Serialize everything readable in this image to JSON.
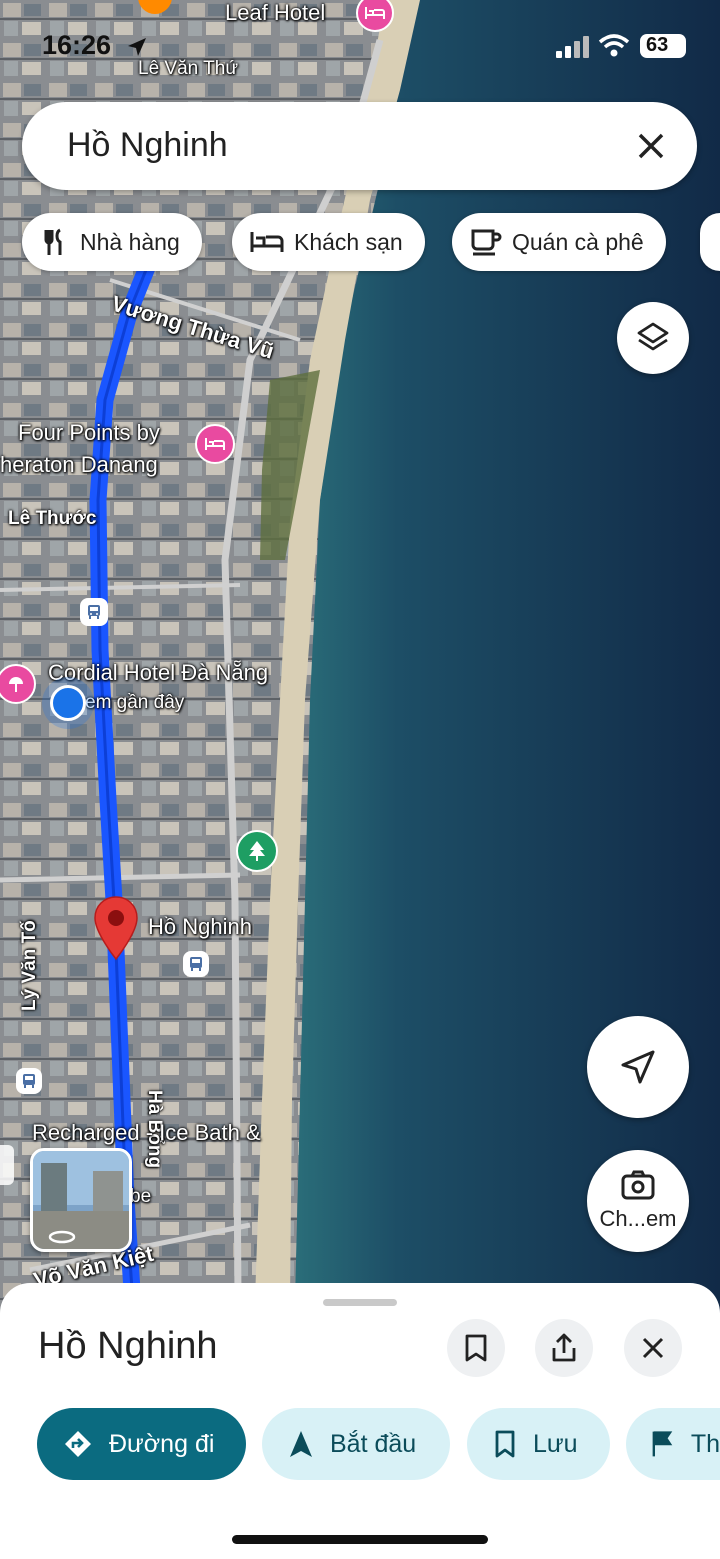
{
  "status_bar": {
    "time": "16:26",
    "battery": "63"
  },
  "search": {
    "query": "Hồ Nghinh"
  },
  "chips": [
    {
      "label": "Nhà hàng",
      "icon": "restaurant-icon"
    },
    {
      "label": "Khách sạn",
      "icon": "hotel-icon"
    },
    {
      "label": "Quán cà phê",
      "icon": "coffee-icon"
    }
  ],
  "map_labels": {
    "leaf_hotel": "Leaf Hotel",
    "le_van_thu": "Lê Văn Thứ",
    "vuong_thua_vu": "Vương Thừa Vũ",
    "four_points_1": "Four Points by",
    "four_points_2": "heraton Danang",
    "le_thuoc": "Lê Thước",
    "cordial": "Cordial Hotel Đà Nẵng",
    "nearby": "em gần đây",
    "ho_nghinh": "Hồ Nghinh",
    "ly_van_to": "Lý Văn Tố",
    "ha_bong": "Hà Bổng",
    "recharged": "Recharged - Ice Bath &",
    "vo_van_kiet": "Võ Văn Kiệt",
    "be": "be"
  },
  "lens_button": {
    "label": "Ch...em"
  },
  "place_sheet": {
    "title": "Hồ Nghinh",
    "actions": [
      {
        "label": "Đường đi",
        "icon": "directions-icon"
      },
      {
        "label": "Bắt đầu",
        "icon": "navigation-arrow-icon"
      },
      {
        "label": "Lưu",
        "icon": "bookmark-icon"
      },
      {
        "label": "Th",
        "icon": "flag-icon"
      }
    ]
  },
  "colors": {
    "route": "#1a56ff",
    "pin": "#e53935",
    "primary": "#0b6b80",
    "sea": "#14304d"
  }
}
